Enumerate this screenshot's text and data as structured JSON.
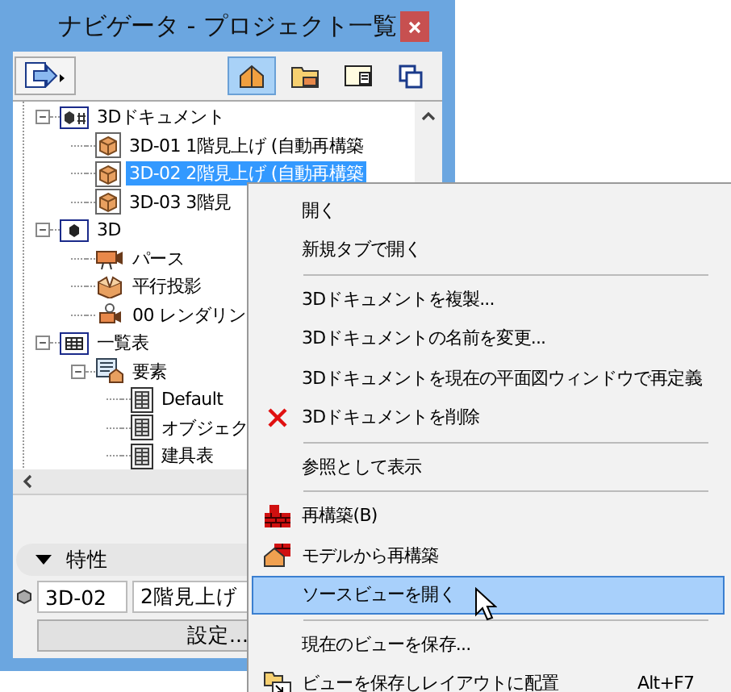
{
  "window": {
    "title": "ナビゲータ - プロジェクト一覧"
  },
  "toolbar": {
    "views": [
      {
        "selected": true
      },
      {
        "selected": false
      },
      {
        "selected": false
      },
      {
        "selected": false
      }
    ]
  },
  "tree": [
    {
      "label": "3Dドキュメント",
      "kind": "doc-folder",
      "expanded": true,
      "selected": false,
      "children": [
        {
          "label": "3D-01 1階見上げ (自動再構築",
          "kind": "doc3d",
          "selected": false
        },
        {
          "label": "3D-02 2階見上げ (自動再構築",
          "kind": "doc3d",
          "selected": true
        },
        {
          "label": "3D-03 3階見",
          "kind": "doc3d",
          "selected": false
        }
      ]
    },
    {
      "label": "3D",
      "kind": "folder3d",
      "expanded": true,
      "selected": false,
      "children": [
        {
          "label": "パース",
          "kind": "camera",
          "selected": false
        },
        {
          "label": "平行投影",
          "kind": "parallel",
          "selected": false
        },
        {
          "label": "00 レンダリン",
          "kind": "render",
          "selected": false
        }
      ]
    },
    {
      "label": "一覧表",
      "kind": "schedule-folder",
      "expanded": true,
      "selected": false,
      "children": [
        {
          "label": "要素",
          "kind": "element-folder",
          "expanded": true,
          "selected": false,
          "children": [
            {
              "label": "Default",
              "kind": "table",
              "selected": false
            },
            {
              "label": "オブジェク",
              "kind": "table",
              "selected": false
            },
            {
              "label": "建具表",
              "kind": "table",
              "selected": false
            }
          ]
        }
      ]
    }
  ],
  "properties": {
    "heading": "特性",
    "expanded": true,
    "id": "3D-02",
    "name": "2階見上げ",
    "button": "設定..."
  },
  "context_menu": {
    "items": [
      {
        "kind": "plain",
        "label": "開く",
        "selected": false
      },
      {
        "kind": "plain",
        "label": "新規タブで開く",
        "selected": false
      },
      {
        "kind": "separator"
      },
      {
        "kind": "plain",
        "label": "3Dドキュメントを複製...",
        "selected": false
      },
      {
        "kind": "plain",
        "label": "3Dドキュメントの名前を変更...",
        "selected": false
      },
      {
        "kind": "plain",
        "label": "3Dドキュメントを現在の平面図ウィンドウで再定義",
        "selected": false
      },
      {
        "kind": "delete",
        "label": "3Dドキュメントを削除",
        "selected": false
      },
      {
        "kind": "separator"
      },
      {
        "kind": "plain",
        "label": "参照として表示",
        "selected": false
      },
      {
        "kind": "separator"
      },
      {
        "kind": "rebuild",
        "label": "再構築(B)",
        "selected": false
      },
      {
        "kind": "rebuild-model",
        "label": "モデルから再構築",
        "selected": false
      },
      {
        "kind": "plain",
        "label": "ソースビューを開く",
        "selected": true
      },
      {
        "kind": "separator"
      },
      {
        "kind": "plain",
        "label": "現在のビューを保存...",
        "selected": false
      },
      {
        "kind": "place",
        "label": "ビューを保存しレイアウトに配置",
        "shortcut": "Alt+F7",
        "selected": false
      }
    ]
  }
}
